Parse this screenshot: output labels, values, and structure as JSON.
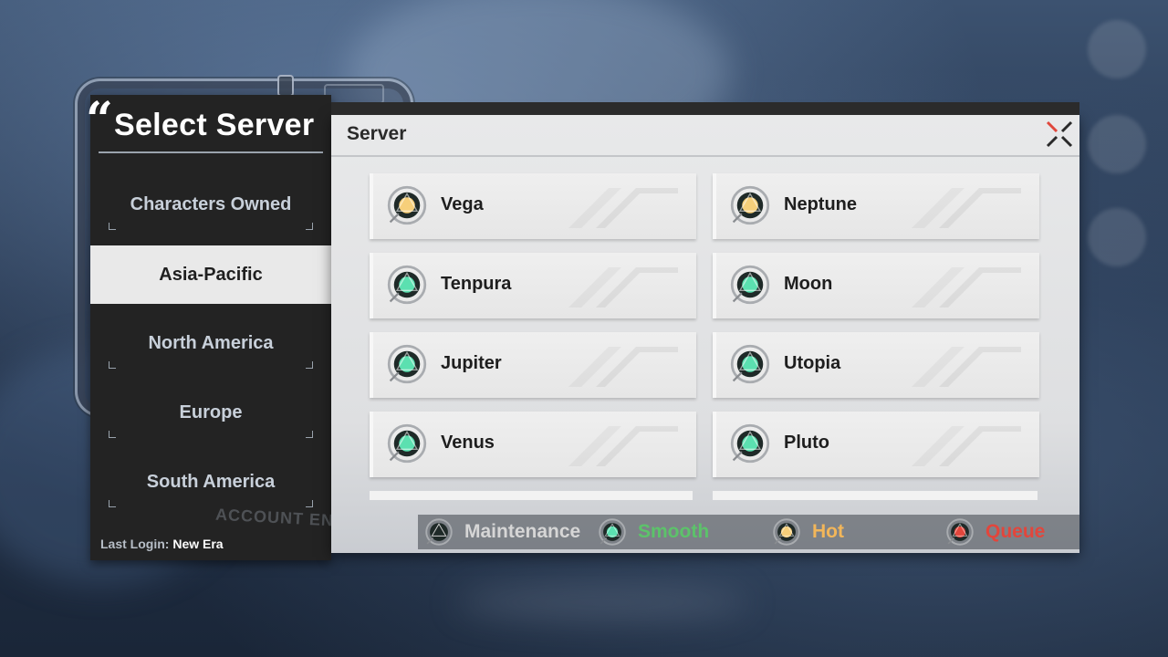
{
  "title": "Select Server",
  "regions": [
    {
      "label": "Characters Owned",
      "active": false
    },
    {
      "label": "Asia-Pacific",
      "active": true
    },
    {
      "label": "North America",
      "active": false
    },
    {
      "label": "Europe",
      "active": false
    },
    {
      "label": "South America",
      "active": false
    }
  ],
  "last_login": {
    "label": "Last Login:",
    "value": "New Era"
  },
  "background_text": "ACCOUNT ENTRY",
  "main": {
    "header": "Server"
  },
  "servers": [
    {
      "name": "Vega",
      "status": "hot"
    },
    {
      "name": "Neptune",
      "status": "hot"
    },
    {
      "name": "Tenpura",
      "status": "smooth"
    },
    {
      "name": "Moon",
      "status": "smooth"
    },
    {
      "name": "Jupiter",
      "status": "smooth"
    },
    {
      "name": "Utopia",
      "status": "smooth"
    },
    {
      "name": "Venus",
      "status": "smooth"
    },
    {
      "name": "Pluto",
      "status": "smooth"
    }
  ],
  "legend": [
    {
      "label": "Maintenance",
      "status": "maintenance",
      "color": "#d6d6d6"
    },
    {
      "label": "Smooth",
      "status": "smooth",
      "color": "#5cc36a"
    },
    {
      "label": "Hot",
      "status": "hot",
      "color": "#f2b65a"
    },
    {
      "label": "Queue",
      "status": "queue",
      "color": "#e2463c"
    }
  ],
  "status_colors": {
    "maintenance": "#2a2a2a",
    "smooth": "#5be0b0",
    "hot": "#f6cf7a",
    "queue": "#e2463c"
  },
  "icons": {
    "close": "close-x-icon",
    "status": "status-orb-icon"
  }
}
